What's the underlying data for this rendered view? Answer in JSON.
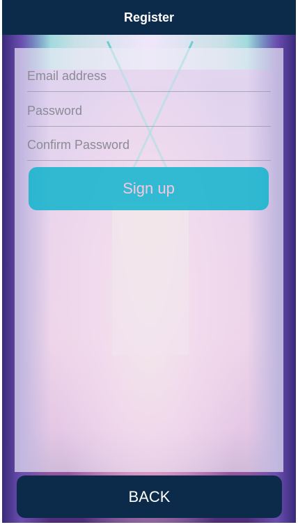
{
  "header": {
    "title": "Register"
  },
  "form": {
    "email_placeholder": "Email address",
    "password_placeholder": "Password",
    "confirm_password_placeholder": "Confirm Password",
    "signup_label": "Sign up"
  },
  "footer": {
    "back_label": "BACK"
  },
  "colors": {
    "header_bg": "#0c2b4a",
    "signup_bg": "#10b4cd",
    "back_bg": "#0c2b4a"
  }
}
